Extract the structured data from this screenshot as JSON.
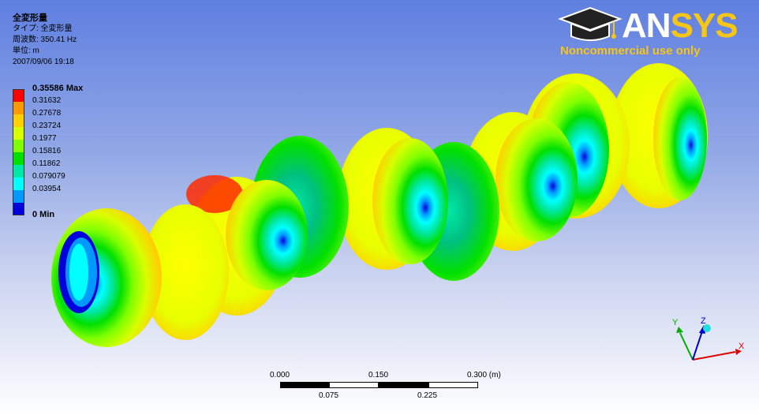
{
  "info": {
    "title": "全変形量",
    "type_line": "タイプ: 全変形量",
    "frequency_line": "周波数: 350.41  Hz",
    "unit_line": "単位: m",
    "date_line": "2007/09/06 19:18"
  },
  "legend": {
    "items": [
      {
        "label": "0.35586 Max",
        "color": "#ff0000",
        "bold": true
      },
      {
        "label": "0.31632",
        "color": "#ff9900",
        "bold": false
      },
      {
        "label": "0.27678",
        "color": "#ffd000",
        "bold": false
      },
      {
        "label": "0.23724",
        "color": "#d8ff00",
        "bold": false
      },
      {
        "label": "0.1977",
        "color": "#7fff00",
        "bold": false
      },
      {
        "label": "0.15816",
        "color": "#00e000",
        "bold": false
      },
      {
        "label": "0.11862",
        "color": "#00e8a8",
        "bold": false
      },
      {
        "label": "0.079079",
        "color": "#00ffff",
        "bold": false
      },
      {
        "label": "0.03954",
        "color": "#0099ff",
        "bold": false
      },
      {
        "label": "0 Min",
        "color": "#0000dd",
        "bold": true
      }
    ]
  },
  "logo": {
    "brand_a": "AN",
    "brand_b": "SYS",
    "tagline": "Noncommercial use only",
    "icon": "graduation-cap-icon"
  },
  "scale_bar": {
    "top_labels": [
      "0.000",
      "0.150",
      "0.300 (m)"
    ],
    "bottom_labels": [
      "0.075",
      "0.225"
    ]
  },
  "triad": {
    "x_label": "X",
    "y_label": "Y",
    "z_label": "Z",
    "x_color": "#dd0000",
    "y_color": "#00aa00",
    "z_color": "#0000cc"
  }
}
